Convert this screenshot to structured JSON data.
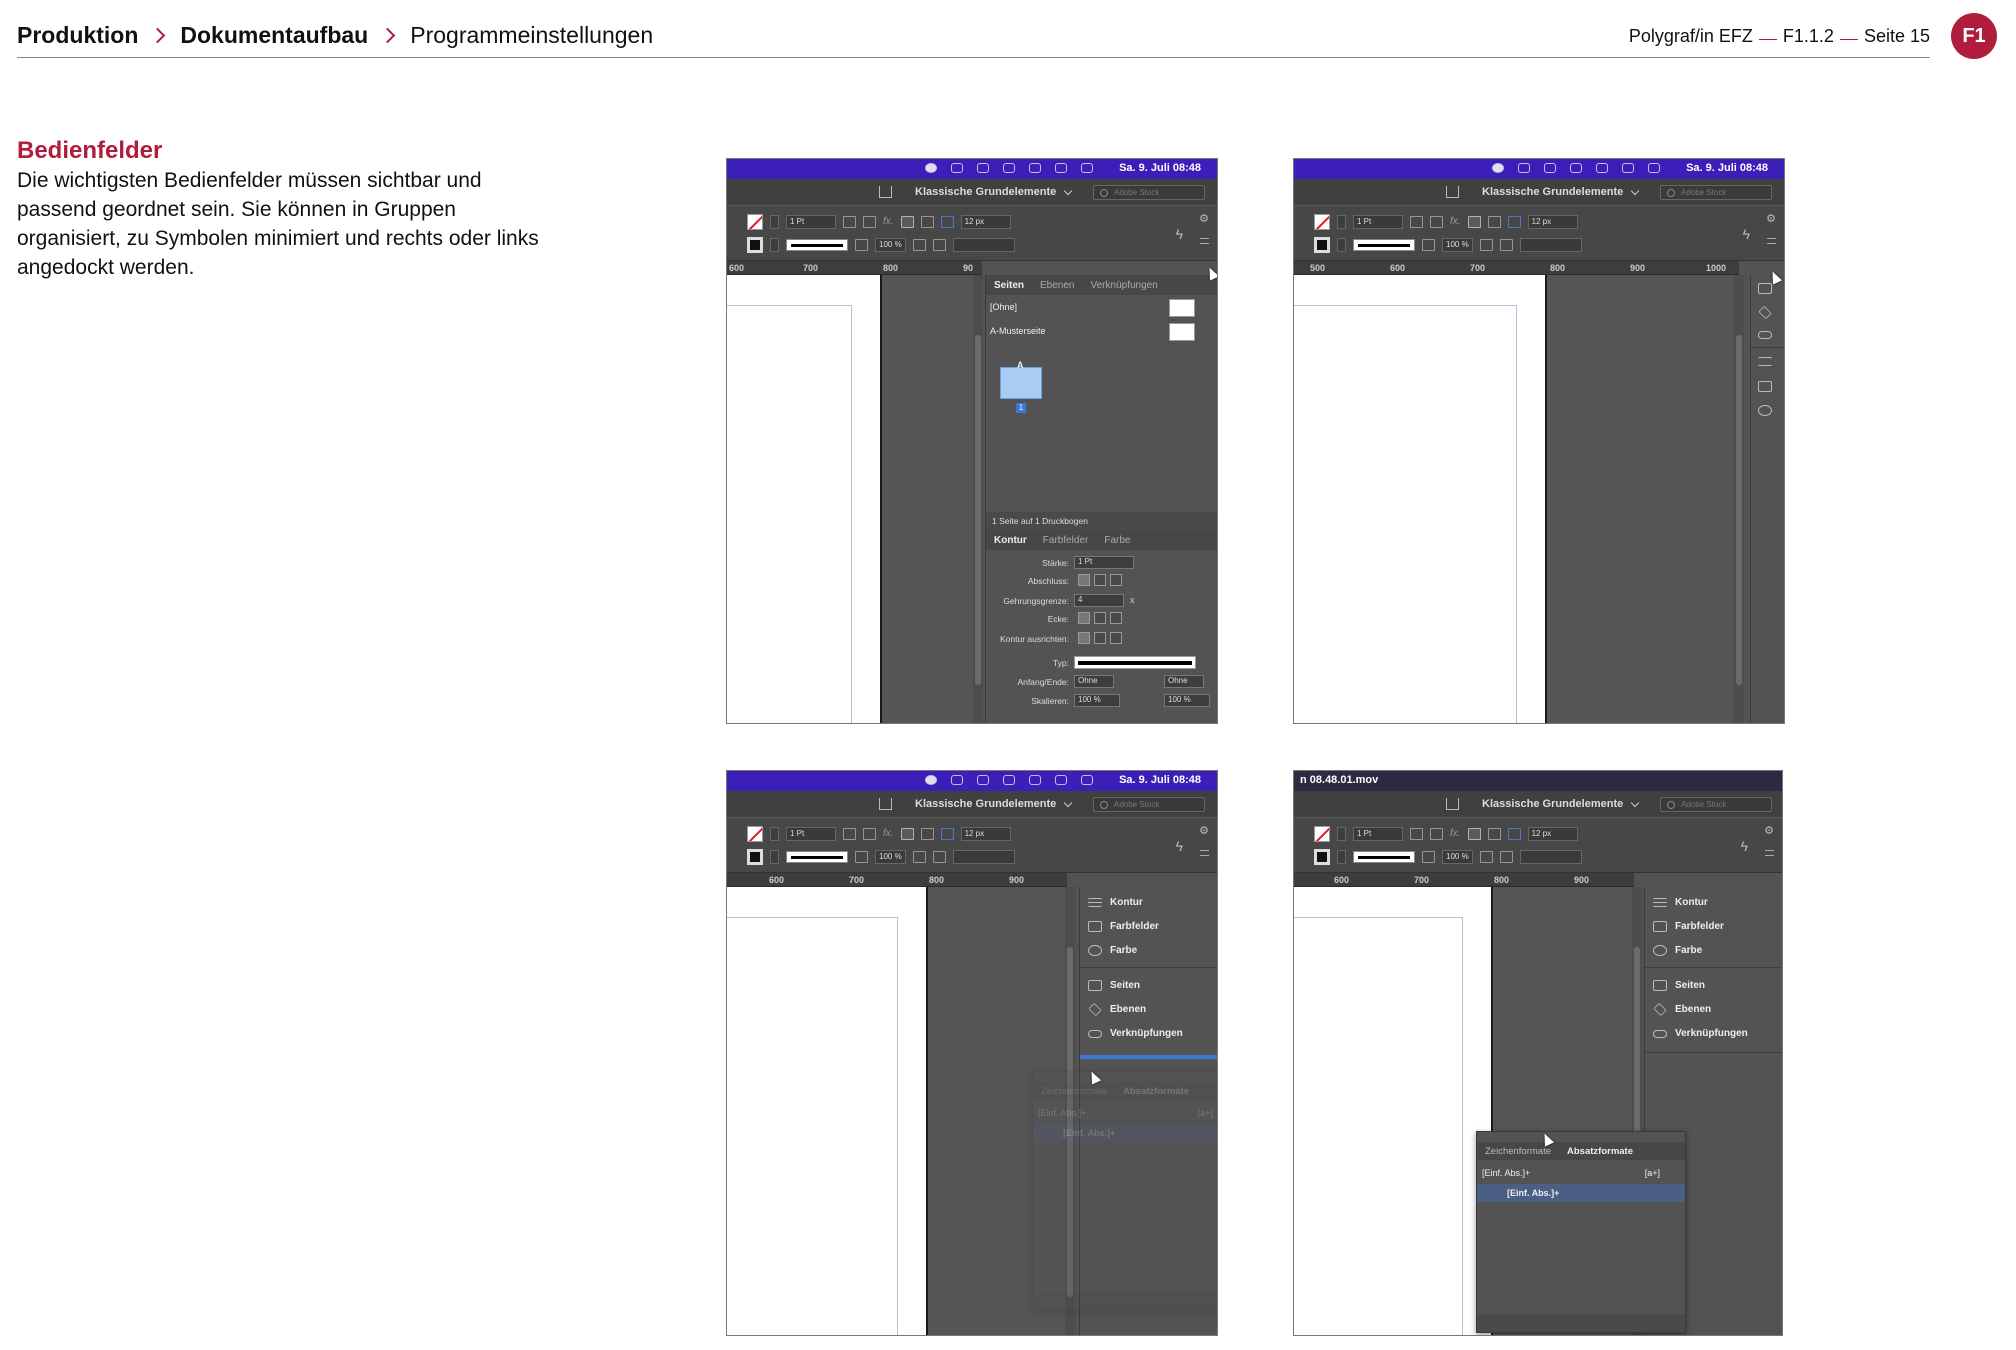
{
  "header": {
    "breadcrumb": [
      "Produktion",
      "Dokumentaufbau",
      "Programmeinstellungen"
    ],
    "course": "Polygraf/in EFZ",
    "code": "F1.1.2",
    "page": "Seite 15",
    "badge": "F1"
  },
  "section": {
    "title": "Bedienfelder",
    "body": "Die wichtigsten Bedienfelder müssen sichtbar und passend geordnet sein. Sie können in Gruppen organisiert, zu Symbolen minimiert und rechts oder links angedockt werden."
  },
  "app": {
    "clock": "Sa. 9. Juli  08:48",
    "workspace": "Klassische Grundelemente",
    "stock_placeholder": "Adobe Stock",
    "stroke_weight": "1 Pt",
    "spacing": "12 px",
    "scale": "100 %",
    "movie_title": "n 08.48.01.mov"
  },
  "shot1": {
    "ruler": [
      "600",
      "700",
      "800",
      "90"
    ],
    "pages_tabs": [
      "Seiten",
      "Ebenen",
      "Verknüpfungen"
    ],
    "none_master": "[Ohne]",
    "a_master": "A-Musterseite",
    "master_letter": "A",
    "page_number": "1",
    "pages_footer": "1 Seite auf 1 Druckbogen",
    "stroke_tabs": [
      "Kontur",
      "Farbfelder",
      "Farbe"
    ],
    "stroke_labels": {
      "weight": "Stärke:",
      "cap": "Abschluss:",
      "miter": "Gehrungsgrenze:",
      "corner": "Ecke:",
      "align": "Kontur ausrichten:",
      "type": "Typ:",
      "startend": "Anfang/Ende:",
      "scale": "Skalieren:"
    },
    "weight_value": "1 Pt",
    "miter_value": "4",
    "miter_unit": "x",
    "start_value": "Ohne",
    "end_value": "Ohne",
    "scale_value": "100 %",
    "scale_value2": "100 %"
  },
  "shot2": {
    "ruler": [
      "500",
      "600",
      "700",
      "800",
      "900",
      "1000"
    ]
  },
  "shot3": {
    "ruler": [
      "600",
      "700",
      "800",
      "900"
    ],
    "ghost_tabs": [
      "Zeichenformate",
      "Absatzformate"
    ],
    "ghost_row": "[Einf. Abs.]+",
    "ghost_row_sel": "[Einf. Abs.]+",
    "ghost_shortcut": "[a+]"
  },
  "shot4": {
    "ruler": [
      "600",
      "700",
      "800",
      "900"
    ],
    "float_tabs": [
      "Zeichenformate",
      "Absatzformate"
    ],
    "row": "[Einf. Abs.]+",
    "row_sel": "[Einf. Abs.]+",
    "shortcut": "[a+]"
  },
  "dock": {
    "group1": [
      "Kontur",
      "Farbfelder",
      "Farbe"
    ],
    "group2": [
      "Seiten",
      "Ebenen",
      "Verknüpfungen"
    ]
  },
  "colors": {
    "accent": "#b01c3b",
    "menubar": "#3b1fb8",
    "panel": "#535353"
  }
}
